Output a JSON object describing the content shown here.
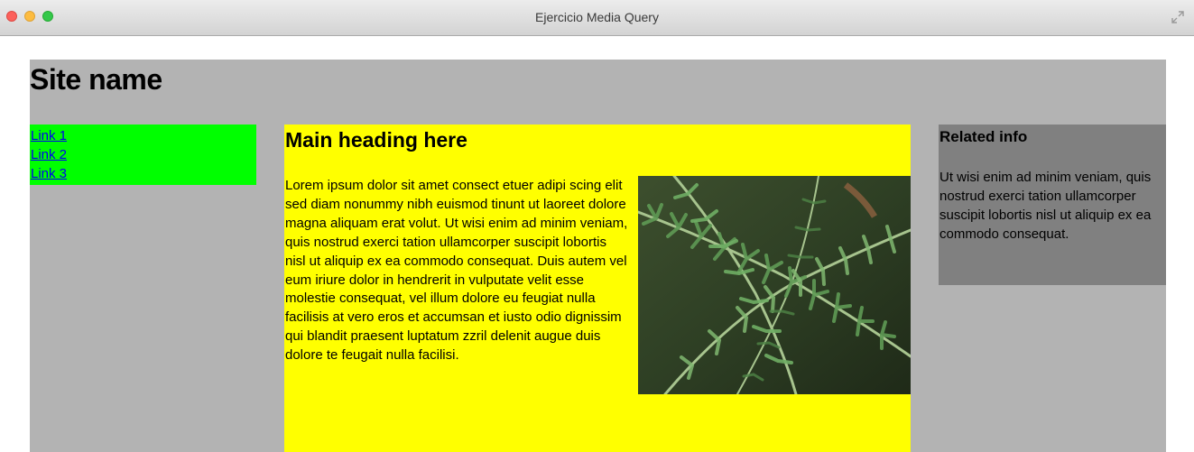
{
  "window": {
    "title": "Ejercicio Media Query",
    "buttons": [
      "close",
      "minimize",
      "zoom"
    ],
    "fullscreen_icon": "fullscreen-arrows-icon"
  },
  "page": {
    "site_name": "Site name",
    "background_color": "#b3b3b3",
    "nav": {
      "background_color": "#00ff00",
      "links": [
        {
          "label": "Link 1"
        },
        {
          "label": "Link 2"
        },
        {
          "label": "Link 3"
        }
      ]
    },
    "main": {
      "background_color": "#ffff00",
      "heading": "Main heading here",
      "body": "Lorem ipsum dolor sit amet consect etuer adipi scing elit sed diam nonummy nibh euismod tinunt ut laoreet dolore magna aliquam erat volut. Ut wisi enim ad minim veniam, quis nostrud exerci tation ullamcorper suscipit lobortis nisl ut aliquip ex ea commodo consequat. Duis autem vel eum iriure dolor in hendrerit in vulputate velit esse molestie consequat, vel illum dolore eu feugiat nulla facilisis at vero eros et accumsan et iusto odio dignissim qui blandit praesent luptatum zzril delenit augue duis dolore te feugait nulla facilisi.",
      "image": "fern-photo"
    },
    "aside": {
      "background_color": "#808080",
      "heading": "Related info",
      "body": "Ut wisi enim ad minim veniam, quis nostrud exerci tation ullamcorper suscipit lobortis nisl ut aliquip ex ea commodo consequat."
    }
  }
}
